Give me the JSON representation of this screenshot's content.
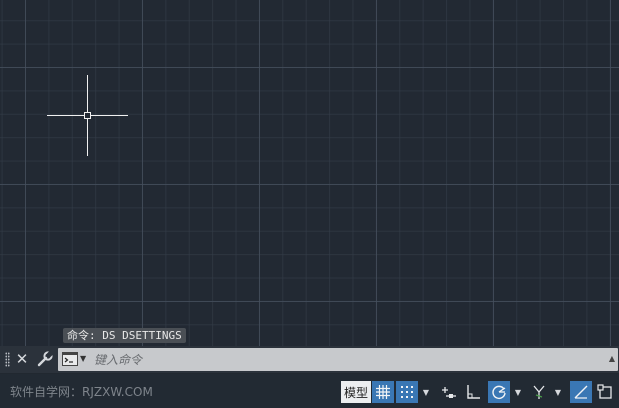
{
  "command": {
    "history_text": "命令: DS DSETTINGS",
    "input_placeholder": "键入命令",
    "input_value": ""
  },
  "statusbar": {
    "watermark": "软件自学网：RJZXW.COM",
    "model_label": "模型",
    "toggles": [
      {
        "name": "grid-display",
        "icon": "grid-icon",
        "active": true
      },
      {
        "name": "snap-mode",
        "icon": "snap-icon",
        "active": true
      },
      {
        "name": "infer-constraints",
        "icon": "infer-constraints-icon",
        "active": false
      },
      {
        "name": "ortho-mode",
        "icon": "ortho-icon",
        "active": false
      },
      {
        "name": "polar-tracking",
        "icon": "polar-tracking-icon",
        "active": true
      },
      {
        "name": "isodraft",
        "icon": "isodraft-icon",
        "active": false
      },
      {
        "name": "object-snap-tracking",
        "icon": "object-snap-tracking-icon",
        "active": true
      },
      {
        "name": "object-snap",
        "icon": "object-snap-icon",
        "active": false
      }
    ]
  },
  "colors": {
    "canvas_bg": "#222933",
    "grid_major": "#46505e",
    "grid_minor": "#343d49",
    "active_toggle": "#3a77b4",
    "command_input_bg": "#c7c9cc"
  }
}
